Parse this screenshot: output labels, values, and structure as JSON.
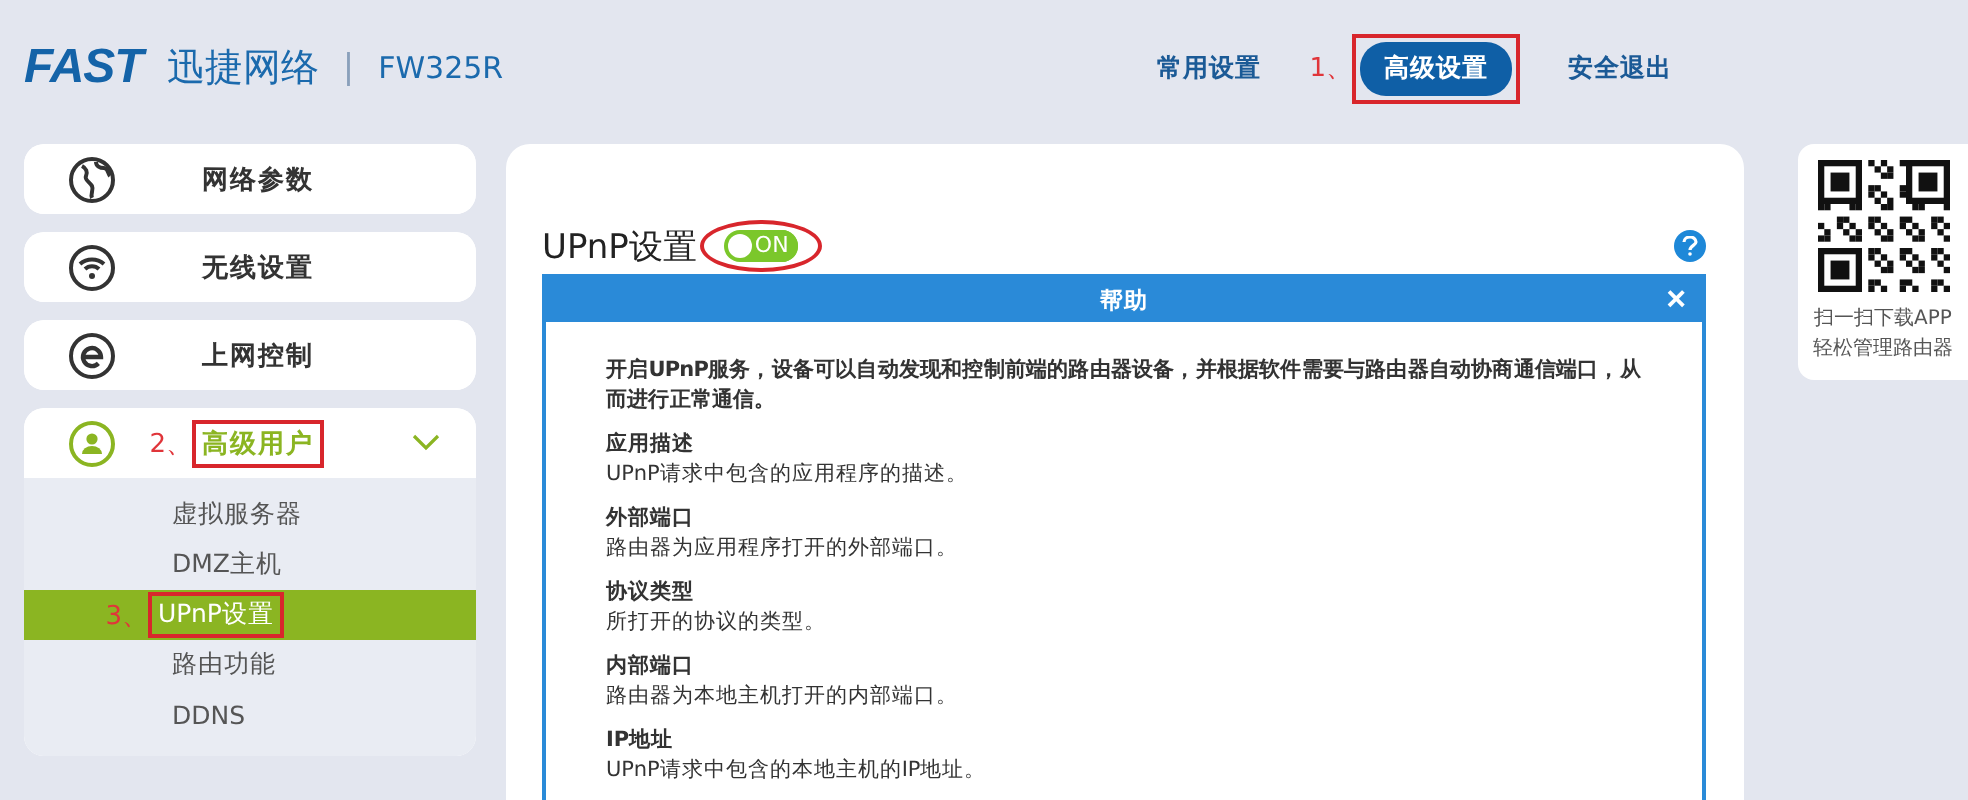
{
  "header": {
    "logo": "FAST",
    "brand": "迅捷网络",
    "separator": "|",
    "model": "FW325R",
    "nav": [
      {
        "label": "常用设置",
        "selected": false,
        "highlighted": false
      },
      {
        "label": "高级设置",
        "selected": true,
        "highlighted": true,
        "annotation": "1、"
      },
      {
        "label": "安全退出",
        "selected": false,
        "highlighted": false
      }
    ]
  },
  "sidebar": {
    "items": [
      {
        "label": "网络参数",
        "kind": "globe",
        "expanded": false,
        "highlighted": false
      },
      {
        "label": "无线设置",
        "kind": "wifi",
        "expanded": false,
        "highlighted": false
      },
      {
        "label": "上网控制",
        "kind": "e",
        "expanded": false,
        "highlighted": false
      },
      {
        "label": "高级用户",
        "kind": "user",
        "expanded": true,
        "highlighted": true,
        "annotation": "2、",
        "children": [
          {
            "label": "虚拟服务器",
            "selected": false,
            "highlighted": false
          },
          {
            "label": "DMZ主机",
            "selected": false,
            "highlighted": false
          },
          {
            "label": "UPnP设置",
            "selected": true,
            "highlighted": true,
            "annotation": "3、"
          },
          {
            "label": "路由功能",
            "selected": false,
            "highlighted": false
          },
          {
            "label": "DDNS",
            "selected": false,
            "highlighted": false
          }
        ]
      }
    ]
  },
  "main": {
    "title": "UPnP设置",
    "toggle": {
      "label": "ON",
      "on": true,
      "highlighted": true
    },
    "help": {
      "title": "帮助",
      "close": "×",
      "intro": "开启UPnP服务，设备可以自动发现和控制前端的路由器设备，并根据软件需要与路由器自动协商通信端口，从而进行正常通信。",
      "sections": [
        {
          "title": "应用描述",
          "text": "UPnP请求中包含的应用程序的描述。"
        },
        {
          "title": "外部端口",
          "text": "路由器为应用程序打开的外部端口。"
        },
        {
          "title": "协议类型",
          "text": "所打开的协议的类型。"
        },
        {
          "title": "内部端口",
          "text": "路由器为本地主机打开的内部端口。"
        },
        {
          "title": "IP地址",
          "text": "UPnP请求中包含的本地主机的IP地址。"
        }
      ]
    }
  },
  "qr": {
    "caption": [
      "扫一扫下载APP",
      "轻松管理路由器"
    ]
  }
}
